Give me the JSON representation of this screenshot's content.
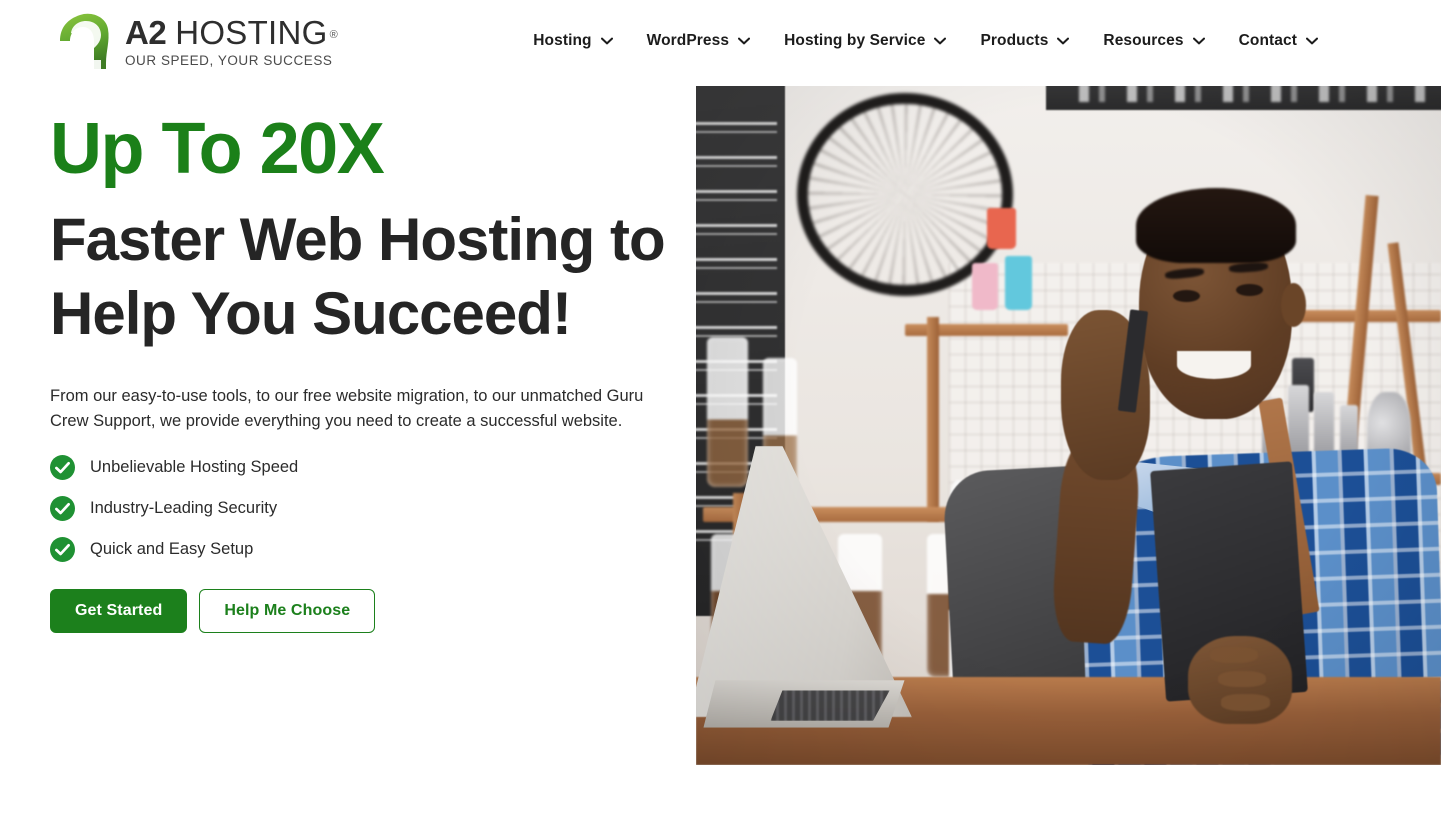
{
  "header": {
    "brand": {
      "mark_icon": "a2-logo-mark",
      "name_bold": "A2",
      "name_light": "HOSTING",
      "registered_mark": "®",
      "tagline": "OUR SPEED, YOUR SUCCESS"
    },
    "nav": [
      {
        "label": "Hosting",
        "icon": "chevron-down-icon",
        "name": "hosting"
      },
      {
        "label": "WordPress",
        "icon": "chevron-down-icon",
        "name": "wordpress"
      },
      {
        "label": "Hosting by Service",
        "icon": "chevron-down-icon",
        "name": "hosting-by-service"
      },
      {
        "label": "Products",
        "icon": "chevron-down-icon",
        "name": "products"
      },
      {
        "label": "Resources",
        "icon": "chevron-down-icon",
        "name": "resources"
      },
      {
        "label": "Contact",
        "icon": "chevron-down-icon",
        "name": "contact"
      }
    ]
  },
  "hero": {
    "eyebrow": "Up To 20X",
    "headline": "Faster Web Hosting to Help You Succeed!",
    "lede": "From our easy-to-use tools, to our free website migration, to our unmatched Guru Crew Support, we provide everything you need to create a successful website.",
    "features": [
      {
        "label": "Unbelievable Hosting Speed",
        "icon": "check-circle-icon"
      },
      {
        "label": "Industry-Leading Security",
        "icon": "check-circle-icon"
      },
      {
        "label": "Quick and Easy Setup",
        "icon": "check-circle-icon"
      }
    ],
    "cta_primary": "Get Started",
    "cta_secondary": "Help Me Choose",
    "image_alt": "Smiling small-business owner in a blue plaid shirt and apron talking on a mobile phone behind a cafe counter with a laptop, shelves of glass jars and a bicycle wheel on the wall"
  },
  "colors": {
    "brand_green": "#1c801c",
    "eyebrow_green": "#1b8019",
    "headline_ink": "#252525",
    "body_ink": "#2b2b2b",
    "page_bg": "#ffffff"
  }
}
